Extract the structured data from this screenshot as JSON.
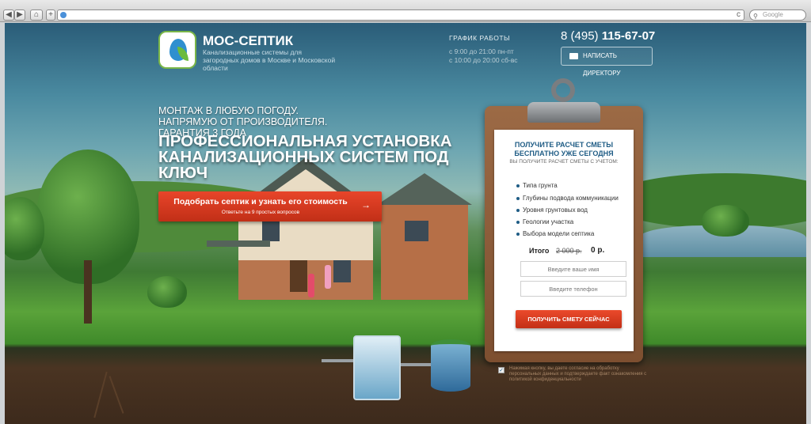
{
  "browser": {
    "search_placeholder": "Google",
    "nav_back": "◀",
    "nav_fwd": "▶",
    "home": "⌂",
    "new_tab": "+",
    "reload": "c"
  },
  "header": {
    "brand": "МОС-СЕПТИК",
    "tagline": "Канализационные системы для загородных домов в Москве и Московской области",
    "schedule_title": "ГРАФИК РАБОТЫ",
    "schedule_lines": [
      "с 9:00 до 21:00 пн-пт",
      "с 10:00 до 20:00 сб-вс"
    ],
    "phone_prefix": "8 (495)",
    "phone_number": "115-67-07",
    "director_button": "НАПИСАТЬ ДИРЕКТОРУ"
  },
  "hero": {
    "subtitle": "МОНТАЖ В ЛЮБУЮ ПОГОДУ. НАПРЯМУЮ ОТ ПРОИЗВОДИТЕЛЯ. ГАРАНТИЯ 3 ГОДА",
    "title": "ПРОФЕССИОНАЛЬНАЯ УСТАНОВКА КАНАЛИЗАЦИОННЫХ СИСТЕМ ПОД КЛЮЧ",
    "cta_main": "Подобрать септик и узнать его стоимость",
    "cta_sub": "Ответьте на 9 простых вопросов"
  },
  "form": {
    "heading_1": "ПОЛУЧИТЕ РАСЧЕТ СМЕТЫ",
    "heading_2": "БЕСПЛАТНО УЖЕ СЕГОДНЯ",
    "heading_3": "ВЫ ПОЛУЧИТЕ РАСЧЕТ СМЕТЫ С УЧЕТОМ:",
    "items": [
      "Типа грунта",
      "Глубины подвода коммуникации",
      "Уровня грунтовых вод",
      "Геологии участка",
      "Выбора модели септика"
    ],
    "total_label": "Итого",
    "old_price": "2 000 р.",
    "new_price": "0 р.",
    "name_placeholder": "Введите ваше имя",
    "phone_placeholder": "Введите телефон",
    "submit": "ПОЛУЧИТЬ СМЕТУ СЕЙЧАС",
    "consent": "Нажимая кнопку, вы даете согласие на обработку персональных данных и подтверждаете факт ознакомления с политикой конфиденциальности",
    "checkbox_mark": "✓"
  },
  "colors": {
    "accent": "#d93a1f",
    "brand_blue": "#1f5c85",
    "board": "#8a5a38"
  }
}
